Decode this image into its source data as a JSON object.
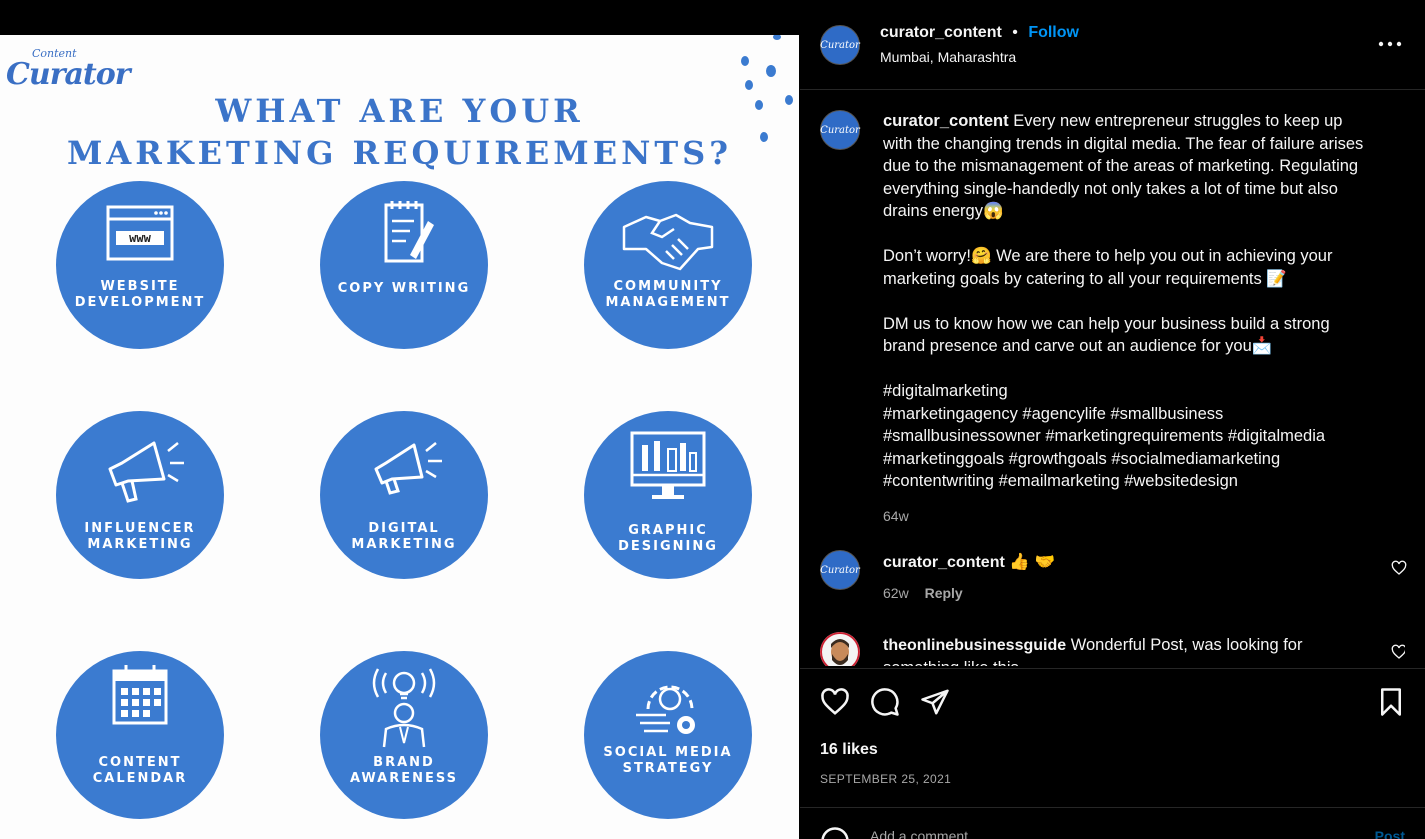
{
  "post": {
    "logo_small": "Content",
    "logo_big": "Curator",
    "headline_line1": "WHAT ARE YOUR",
    "headline_line2": "MARKETING REQUIREMENTS?",
    "accent_color": "#3b7bd0",
    "services": [
      {
        "line1": "WEBSITE",
        "line2": "DEVELOPMENT",
        "icon": "browser-www-icon",
        "www": "www"
      },
      {
        "line1": "COPY WRITING",
        "line2": "",
        "icon": "notepad-pencil-icon"
      },
      {
        "line1": "COMMUNITY",
        "line2": "MANAGEMENT",
        "icon": "handshake-icon"
      },
      {
        "line1": "INFLUENCER",
        "line2": "MARKETING",
        "icon": "megaphone-icon"
      },
      {
        "line1": "DIGITAL",
        "line2": "MARKETING",
        "icon": "megaphone-icon"
      },
      {
        "line1": "GRAPHIC",
        "line2": "DESIGNING",
        "icon": "monitor-design-icon"
      },
      {
        "line1": "CONTENT",
        "line2": "CALENDAR",
        "icon": "calendar-icon"
      },
      {
        "line1": "BRAND",
        "line2": "AWARENESS",
        "icon": "lightbulb-person-icon"
      },
      {
        "line1": "SOCIAL MEDIA",
        "line2": "STRATEGY",
        "icon": "gear-strategy-icon"
      }
    ]
  },
  "header": {
    "avatar_text": "Curator",
    "username": "curator_content",
    "separator": "•",
    "follow_label": "Follow",
    "location": "Mumbai, Maharashtra",
    "more_icon": "more-options-icon"
  },
  "caption": {
    "username": "curator_content",
    "paragraph1": "Every new entrepreneur struggles to keep up with the changing trends in digital media. The fear of failure arises due to the mismanagement of the areas of marketing. Regulating everything single-handedly not only takes a lot of time but also drains energy😱",
    "paragraph2": "Don’t worry!🤗 We are there to help you out in achieving your marketing goals by catering to all your requirements 📝",
    "paragraph3": "DM us to know how we can help your business build a strong brand presence and carve out an audience for you📩",
    "hashtags": [
      "#digitalmarketing",
      "#marketingagency #agencylife #smallbusiness",
      "#smallbusinessowner #marketingrequirements #digitalmedia",
      "#marketinggoals #growthgoals #socialmediamarketing",
      "#contentwriting #emailmarketing #websitedesign"
    ],
    "time": "64w"
  },
  "comments": [
    {
      "username": "curator_content",
      "text": "👍 🤝",
      "time": "62w",
      "reply_label": "Reply",
      "avatar_text": "Curator"
    },
    {
      "username": "theonlinebusinessguide",
      "text": "Wonderful Post, was looking for",
      "cut_text": "something like this ..."
    }
  ],
  "actions": {
    "likes": "16 likes",
    "date": "SEPTEMBER 25, 2021",
    "add_comment_placeholder": "Add a comment...",
    "post_label": "Post"
  }
}
